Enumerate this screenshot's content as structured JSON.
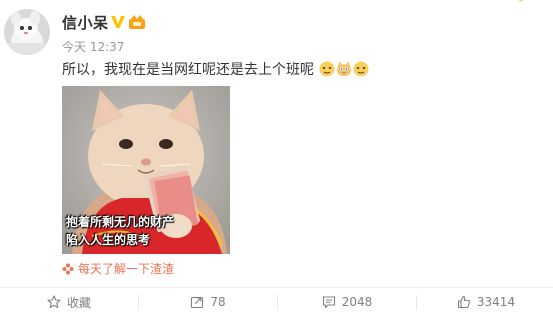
{
  "post": {
    "username": "信小呆",
    "time": "今天 12:37",
    "text": "所以，我现在是当网红呢还是去上个班呢",
    "emojis": [
      "doge-emoji",
      "cat-emoji",
      "doge-emoji"
    ]
  },
  "image": {
    "caption_line1": "抱着所剩无几的财产",
    "caption_line2": "陷入人生的思考"
  },
  "source": {
    "label": "每天了解一下渣渣"
  },
  "actions": {
    "favorite_label": "收藏",
    "repost_count": "78",
    "comment_count": "2048",
    "like_count": "33414"
  },
  "colors": {
    "source_link": "#eb7350",
    "verified": "#ffc200",
    "muted_text": "#999999"
  }
}
